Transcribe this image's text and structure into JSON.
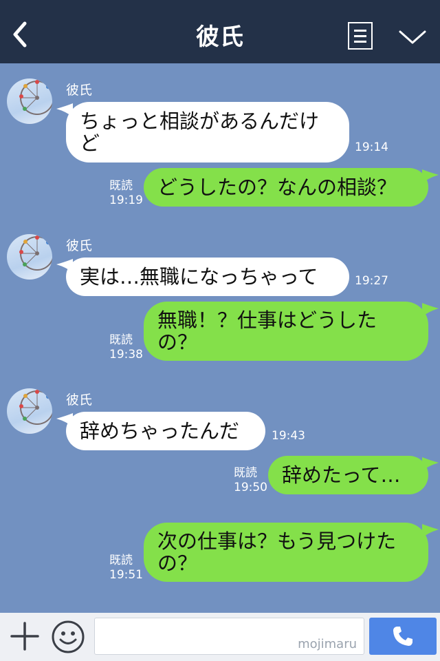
{
  "header": {
    "title": "彼氏",
    "back_icon": "chevron-left-icon",
    "menu_icon": "menu-icon",
    "collapse_icon": "chevron-down-icon"
  },
  "contact": {
    "name": "彼氏"
  },
  "messages": [
    {
      "side": "in",
      "text": "ちょっと相談があるんだけど",
      "time": "19:14"
    },
    {
      "side": "out",
      "text": "どうしたの？なんの相談？",
      "read": "既読",
      "time": "19:19"
    },
    {
      "side": "in",
      "text": "実は…無職になっちゃって",
      "time": "19:27"
    },
    {
      "side": "out",
      "text": "無職！？仕事はどうしたの？",
      "read": "既読",
      "time": "19:38"
    },
    {
      "side": "in",
      "text": "辞めちゃったんだ",
      "time": "19:43"
    },
    {
      "side": "out",
      "text": "辞めたって…",
      "read": "既読",
      "time": "19:50"
    },
    {
      "side": "out",
      "text": "次の仕事は？もう見つけたの？",
      "read": "既読",
      "time": "19:51"
    }
  ],
  "footer": {
    "input_value": "",
    "watermark": "mojimaru",
    "plus_icon": "plus-icon",
    "sticker_icon": "smile-icon",
    "call_icon": "phone-icon"
  },
  "colors": {
    "header_bg": "#233148",
    "chat_bg": "#7291c1",
    "incoming_bubble": "#ffffff",
    "outgoing_bubble": "#84e04a",
    "call_button": "#4f86e6"
  }
}
